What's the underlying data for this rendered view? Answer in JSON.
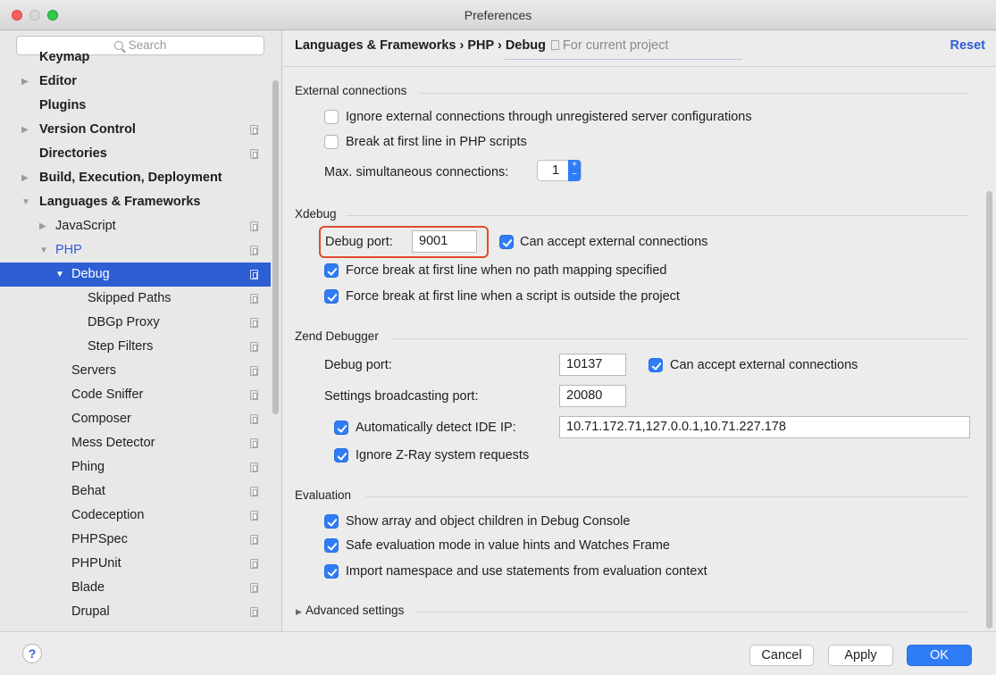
{
  "window": {
    "title": "Preferences",
    "accent_color": "#2e7cf6",
    "selection_color": "#2e5ed4"
  },
  "sidebar": {
    "search_placeholder": "Search",
    "items": [
      {
        "label": "Keymap",
        "level": 0,
        "bold": true,
        "expander": "",
        "copy_icon": false
      },
      {
        "label": "Editor",
        "level": 0,
        "bold": true,
        "expander": "▶",
        "copy_icon": false
      },
      {
        "label": "Plugins",
        "level": 0,
        "bold": true,
        "expander": "",
        "copy_icon": false
      },
      {
        "label": "Version Control",
        "level": 0,
        "bold": true,
        "expander": "▶",
        "copy_icon": true
      },
      {
        "label": "Directories",
        "level": 0,
        "bold": true,
        "expander": "",
        "copy_icon": true
      },
      {
        "label": "Build, Execution, Deployment",
        "level": 0,
        "bold": true,
        "expander": "▶",
        "copy_icon": false
      },
      {
        "label": "Languages & Frameworks",
        "level": 0,
        "bold": true,
        "expander": "▼",
        "copy_icon": false
      },
      {
        "label": "JavaScript",
        "level": 1,
        "bold": false,
        "expander": "▶",
        "copy_icon": true
      },
      {
        "label": "PHP",
        "level": 1,
        "bold": false,
        "expander": "▼",
        "copy_icon": true
      },
      {
        "label": "Debug",
        "level": 2,
        "bold": false,
        "expander": "▼",
        "copy_icon": true,
        "selected": true
      },
      {
        "label": "Skipped Paths",
        "level": 3,
        "bold": false,
        "expander": "",
        "copy_icon": true
      },
      {
        "label": "DBGp Proxy",
        "level": 3,
        "bold": false,
        "expander": "",
        "copy_icon": true
      },
      {
        "label": "Step Filters",
        "level": 3,
        "bold": false,
        "expander": "",
        "copy_icon": true
      },
      {
        "label": "Servers",
        "level": 2,
        "bold": false,
        "expander": "",
        "copy_icon": true
      },
      {
        "label": "Code Sniffer",
        "level": 2,
        "bold": false,
        "expander": "",
        "copy_icon": true
      },
      {
        "label": "Composer",
        "level": 2,
        "bold": false,
        "expander": "",
        "copy_icon": true
      },
      {
        "label": "Mess Detector",
        "level": 2,
        "bold": false,
        "expander": "",
        "copy_icon": true
      },
      {
        "label": "Phing",
        "level": 2,
        "bold": false,
        "expander": "",
        "copy_icon": true
      },
      {
        "label": "Behat",
        "level": 2,
        "bold": false,
        "expander": "",
        "copy_icon": true
      },
      {
        "label": "Codeception",
        "level": 2,
        "bold": false,
        "expander": "",
        "copy_icon": true
      },
      {
        "label": "PHPSpec",
        "level": 2,
        "bold": false,
        "expander": "",
        "copy_icon": true
      },
      {
        "label": "PHPUnit",
        "level": 2,
        "bold": false,
        "expander": "",
        "copy_icon": true
      },
      {
        "label": "Blade",
        "level": 2,
        "bold": false,
        "expander": "",
        "copy_icon": true
      },
      {
        "label": "Drupal",
        "level": 2,
        "bold": false,
        "expander": "",
        "copy_icon": true
      }
    ]
  },
  "header": {
    "breadcrumb": "Languages & Frameworks › PHP › Debug",
    "scope": "For current project",
    "reset_label": "Reset"
  },
  "external": {
    "title": "External connections",
    "ignore_label": "Ignore external connections through unregistered server configurations",
    "ignore_checked": false,
    "break_label": "Break at first line in PHP scripts",
    "break_checked": false,
    "max_label": "Max. simultaneous connections:",
    "max_value": "1"
  },
  "xdebug": {
    "title": "Xdebug",
    "port_label": "Debug port:",
    "port_value": "9001",
    "accept_label": "Can accept external connections",
    "accept_checked": true,
    "force_no_mapping_label": "Force break at first line when no path mapping specified",
    "force_no_mapping_checked": true,
    "force_outside_label": "Force break at first line when a script is outside the project",
    "force_outside_checked": true
  },
  "zend": {
    "title": "Zend Debugger",
    "port_label": "Debug port:",
    "port_value": "10137",
    "accept_label": "Can accept external connections",
    "accept_checked": true,
    "broadcast_label": "Settings broadcasting port:",
    "broadcast_value": "20080",
    "detect_label": "Automatically detect IDE IP:",
    "detect_checked": true,
    "detect_value": "10.71.172.71,127.0.0.1,10.71.227.178",
    "zray_label": "Ignore Z-Ray system requests",
    "zray_checked": true
  },
  "evaluation": {
    "title": "Evaluation",
    "show_children_label": "Show array and object children in Debug Console",
    "show_children_checked": true,
    "safe_mode_label": "Safe evaluation mode in value hints and Watches Frame",
    "safe_mode_checked": true,
    "import_ns_label": "Import namespace and use statements from evaluation context",
    "import_ns_checked": true
  },
  "advanced": {
    "label": "Advanced settings"
  },
  "footer": {
    "help_label": "?",
    "cancel_label": "Cancel",
    "apply_label": "Apply",
    "ok_label": "OK"
  }
}
